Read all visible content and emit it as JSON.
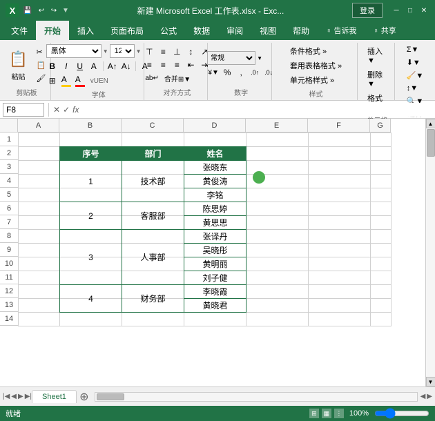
{
  "titleBar": {
    "title": "新建 Microsoft Excel 工作表.xlsx - Exc...",
    "saveLabel": "💾",
    "undoLabel": "↩",
    "redoLabel": "↪",
    "loginLabel": "登录",
    "closeLabel": "✕",
    "minLabel": "─",
    "maxLabel": "□"
  },
  "ribbonTabs": [
    {
      "label": "文件",
      "active": false
    },
    {
      "label": "开始",
      "active": true
    },
    {
      "label": "插入",
      "active": false
    },
    {
      "label": "页面布局",
      "active": false
    },
    {
      "label": "公式",
      "active": false
    },
    {
      "label": "数据",
      "active": false
    },
    {
      "label": "审阅",
      "active": false
    },
    {
      "label": "视图",
      "active": false
    },
    {
      "label": "帮助",
      "active": false
    },
    {
      "label": "♀ 告诉我",
      "active": false
    },
    {
      "label": "♀ 共享",
      "active": false
    }
  ],
  "ribbon": {
    "pasteLabel": "粘贴",
    "cutLabel": "✂",
    "copyLabel": "📋",
    "formatPainterLabel": "🖌",
    "clipboardLabel": "剪贴板",
    "fontName": "黑体",
    "fontSize": "12",
    "boldLabel": "B",
    "italicLabel": "I",
    "underlineLabel": "U",
    "strikeLabel": "A",
    "fontColorLabel": "A",
    "fontGroupLabel": "字体",
    "alignLeft": "≡",
    "alignCenter": "≡",
    "alignRight": "≡",
    "alignTopLabel": "⊤",
    "alignMiddleLabel": "≡",
    "alignBottomLabel": "⊥",
    "wrapLabel": "ab",
    "mergeLabel": "⊞",
    "alignGroupLabel": "对齐方式",
    "percentLabel": "%",
    "commaLabel": ",",
    "decIncLabel": ".0",
    "decDecLabel": ".00",
    "numberLabel": "数字",
    "condFmtLabel": "条件格式 »",
    "tableStyleLabel": "套用表格格式 »",
    "cellStyleLabel": "单元格样式 »",
    "stylesLabel": "样式",
    "cellInsertLabel": "单元格",
    "editLabel": "编辑"
  },
  "formulaBar": {
    "cellRef": "F8",
    "cancelIcon": "✕",
    "confirmIcon": "✓",
    "fxIcon": "fx",
    "formula": ""
  },
  "columns": [
    {
      "label": "",
      "width": 26
    },
    {
      "label": "A",
      "width": 60
    },
    {
      "label": "B",
      "width": 90
    },
    {
      "label": "C",
      "width": 90
    },
    {
      "label": "D",
      "width": 90
    },
    {
      "label": "E",
      "width": 90
    },
    {
      "label": "F",
      "width": 90
    },
    {
      "label": "G",
      "width": 30
    }
  ],
  "rows": [
    1,
    2,
    3,
    4,
    5,
    6,
    7,
    8,
    9,
    10,
    11,
    12,
    13,
    14
  ],
  "tableData": {
    "headers": [
      "序号",
      "部门",
      "姓名"
    ],
    "departments": [
      {
        "id": "1",
        "name": "技术部",
        "people": [
          "张晓东",
          "黄俊涛",
          "李铭"
        ]
      },
      {
        "id": "2",
        "name": "客服部",
        "people": [
          "陈思婷",
          "黄思思"
        ]
      },
      {
        "id": "3",
        "name": "人事部",
        "people": [
          "张译丹",
          "吴晓彤",
          "黄明丽",
          "刘子健"
        ]
      },
      {
        "id": "4",
        "name": "财务部",
        "people": [
          "李晓霞",
          "黄晓君"
        ]
      }
    ]
  },
  "sheetTabs": [
    {
      "label": "Sheet1",
      "active": true
    }
  ],
  "statusBar": {
    "statusText": "就绪",
    "zoomLabel": "100%"
  }
}
